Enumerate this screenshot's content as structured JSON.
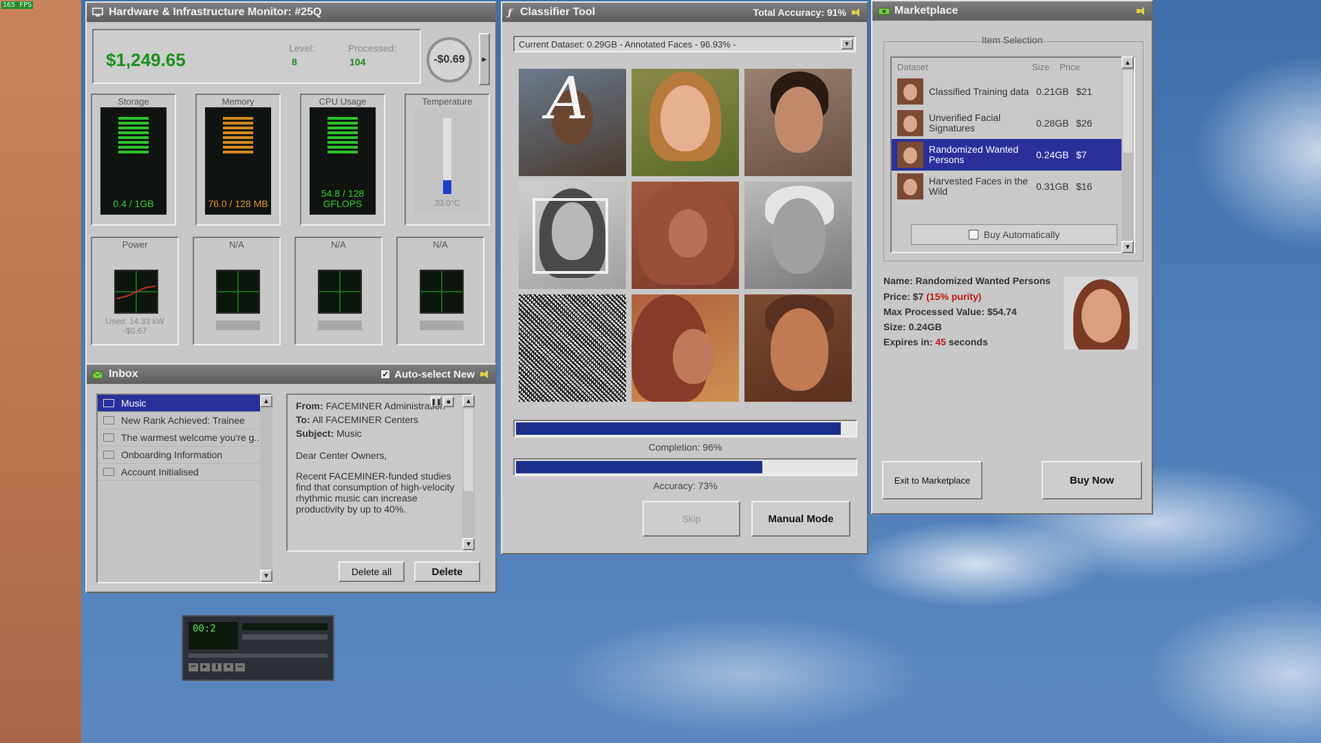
{
  "fps": "165 FPS",
  "hardware": {
    "title": "Hardware & Infrastructure Monitor: #25Q",
    "balance": "$1,249.65",
    "level_label": "Level:",
    "level_value": "8",
    "processed_label": "Processed:",
    "processed_value": "104",
    "rate": "-$0.69",
    "panels": {
      "storage": {
        "label": "Storage",
        "value": "0.4 / 1GB"
      },
      "memory": {
        "label": "Memory",
        "value": "76.0 / 128 MB"
      },
      "cpu": {
        "label": "CPU Usage",
        "value_line1": "54.8 / 128",
        "value_line2": "GFLOPS"
      },
      "temperature": {
        "label": "Temperature",
        "value": "33.0°C"
      },
      "power": {
        "label": "Power",
        "value_line1": "Used: 14.33 kW",
        "value_line2": "-$0.67"
      },
      "na1": {
        "label": "N/A"
      },
      "na2": {
        "label": "N/A"
      },
      "na3": {
        "label": "N/A"
      }
    }
  },
  "inbox": {
    "title": "Inbox",
    "auto_select": "Auto-select New",
    "items": [
      {
        "label": "Music"
      },
      {
        "label": "New Rank Achieved: Trainee"
      },
      {
        "label": "The warmest welcome you're g..."
      },
      {
        "label": "Onboarding Information"
      },
      {
        "label": "Account Initialised"
      }
    ],
    "message": {
      "from_label": "From:",
      "from": "FACEMINER Administration",
      "to_label": "To:",
      "to": "All FACEMINER Centers",
      "subject_label": "Subject:",
      "subject": "Music",
      "greeting": "Dear Center Owners,",
      "body": "Recent FACEMINER-funded studies find that consumption of high-velocity rhythmic music can increase productivity by up to 40%."
    },
    "delete_all": "Delete all",
    "delete": "Delete"
  },
  "classifier": {
    "title": "Classifier Tool",
    "total_accuracy": "Total Accuracy: 91%",
    "dataset": "Current Dataset: 0.29GB - Annotated Faces - 96.93% -",
    "completion_label": "Completion: 96%",
    "completion": 0.96,
    "accuracy_label": "Accuracy: 73%",
    "accuracy": 0.73,
    "skip": "Skip",
    "manual_mode": "Manual Mode"
  },
  "marketplace": {
    "title": "Marketplace",
    "item_selection": "Item Selection",
    "col_dataset": "Dataset",
    "col_size": "Size",
    "col_price": "Price",
    "rows": [
      {
        "name": "Classified Training data",
        "size": "0.21GB",
        "price": "$21"
      },
      {
        "name": "Unverified Facial Signatures",
        "size": "0.28GB",
        "price": "$26"
      },
      {
        "name": "Randomized Wanted Persons",
        "size": "0.24GB",
        "price": "$7"
      },
      {
        "name": "Harvested Faces in the Wild",
        "size": "0.31GB",
        "price": "$16"
      }
    ],
    "buy_auto": "Buy Automatically",
    "detail": {
      "name": "Name: Randomized Wanted Persons",
      "price_prefix": "Price: $7 ",
      "price_purity": "(15% purity)",
      "max_value": "Max Processed Value: $54.74",
      "size": "Size: 0.24GB",
      "expires_prefix": "Expires in: ",
      "expires_value": "45",
      "expires_suffix": " seconds"
    },
    "exit": "Exit to Marketplace",
    "buy_now": "Buy Now"
  },
  "player": {
    "time": "00:2"
  },
  "colors": {
    "accent_selection": "#2a2f9a",
    "money_green": "#1a8f1a",
    "progress_blue": "#1b2f8a",
    "alert_red": "#c01818"
  }
}
